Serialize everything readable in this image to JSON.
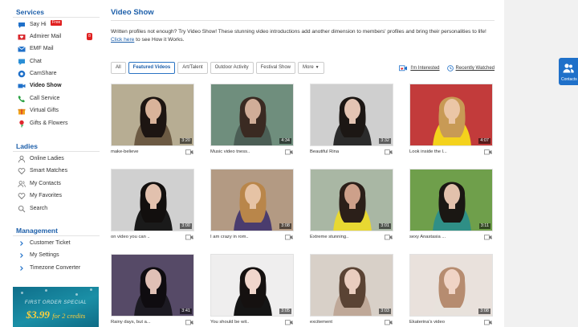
{
  "sidebar": {
    "services_title": "Services",
    "services": [
      {
        "label": "Say Hi",
        "icon": "speech-bubble-icon"
      },
      {
        "label": "Admirer Mail",
        "icon": "mail-heart-icon"
      },
      {
        "label": "EMF Mail",
        "icon": "mail-icon"
      },
      {
        "label": "Chat",
        "icon": "chat-icon"
      },
      {
        "label": "CamShare",
        "icon": "camshare-icon"
      },
      {
        "label": "Video Show",
        "icon": "video-camera-icon"
      },
      {
        "label": "Call Service",
        "icon": "phone-icon"
      },
      {
        "label": "Virtual Gifts",
        "icon": "gift-icon"
      },
      {
        "label": "Gifts & Flowers",
        "icon": "flower-icon"
      }
    ],
    "free_badge": "Free",
    "admirer_count": "8",
    "ladies_title": "Ladies",
    "ladies": [
      {
        "label": "Online Ladies",
        "icon": "person-icon"
      },
      {
        "label": "Smart Matches",
        "icon": "heart-outline-icon"
      },
      {
        "label": "My Contacts",
        "icon": "contacts-icon"
      },
      {
        "label": "My Favorites",
        "icon": "heart-outline-icon"
      },
      {
        "label": "Search",
        "icon": "search-icon"
      }
    ],
    "management_title": "Management",
    "management": [
      {
        "label": "Customer Ticket"
      },
      {
        "label": "My Settings"
      },
      {
        "label": "Timezone Converter"
      }
    ],
    "promo": {
      "line1": "FIRST ORDER SPECIAL",
      "price": "$3.99",
      "tail": "for 2 credits"
    }
  },
  "main": {
    "title": "Video Show",
    "intro_text": "Written profiles not enough? Try Video Show! These stunning video introductions add another dimension to members' profiles and bring their personalities to life!",
    "intro_link": "Click here",
    "intro_tail": "to see How it Works.",
    "filters": [
      "All",
      "Featured Videos",
      "Art/Talent",
      "Outdoor Activity",
      "Festival Show",
      "More"
    ],
    "active_filter": "Featured Videos",
    "im_interested": "I'm Interested",
    "recently_watched": "Recently Watched"
  },
  "videos": [
    {
      "caption": "make-believe",
      "duration": "3:20",
      "bg": "#b7ad93",
      "hair": "#1d1512",
      "skin": "#d9b39a",
      "top": "#6c5a43"
    },
    {
      "caption": "Music video tness..",
      "duration": "4:34",
      "bg": "#6f8e7d",
      "hair": "#3a2a22",
      "skin": "#d0ad98",
      "top": "#4b5e55"
    },
    {
      "caption": "Beautiful Rina",
      "duration": "3:32",
      "bg": "#cfcfcf",
      "hair": "#1c1714",
      "skin": "#e3c4b3",
      "top": "#2b2b2b"
    },
    {
      "caption": "Look inside the l...",
      "duration": "4:07",
      "bg": "#c23b3b",
      "hair": "#c89a55",
      "skin": "#ebc6a6",
      "top": "#f4d21c"
    },
    {
      "caption": "on video you can ..",
      "duration": "3:00",
      "bg": "#d0d0d0",
      "hair": "#120f0e",
      "skin": "#e2c1ae",
      "top": "#1a1a1a"
    },
    {
      "caption": "I am crazy in rom..",
      "duration": "3:08",
      "bg": "#b39a83",
      "hair": "#b9864a",
      "skin": "#e6c3a5",
      "top": "#4a3c6e"
    },
    {
      "caption": "Extreme stunning..",
      "duration": "3:01",
      "bg": "#a9b7a4",
      "hair": "#2b1f19",
      "skin": "#cda08a",
      "top": "#e8d832"
    },
    {
      "caption": "sexy Anastasia ...",
      "duration": "3:11",
      "bg": "#6f9f4b",
      "hair": "#1a1713",
      "skin": "#e2c1ac",
      "top": "#2f8f86"
    },
    {
      "caption": "Rainy days, but a...",
      "duration": "3:41",
      "bg": "#564a67",
      "hair": "#0f0c10",
      "skin": "#e0c0b6",
      "top": "#1c1a22"
    },
    {
      "caption": "You should be wit..",
      "duration": "3:05",
      "bg": "#efeeee",
      "hair": "#151110",
      "skin": "#f0d6cc",
      "top": "#151515"
    },
    {
      "caption": "excitement",
      "duration": "3:03",
      "bg": "#d8d0c8",
      "hair": "#5a4334",
      "skin": "#e9cdbf",
      "top": "#bfa898"
    },
    {
      "caption": "Ekaterina's video",
      "duration": "3:08",
      "bg": "#e9e1dc",
      "hair": "#b68c70",
      "skin": "#f0d4c6",
      "top": "#e8e2dc"
    }
  ],
  "contacts_tab": {
    "label": "Contacts"
  },
  "colors": {
    "accent": "#1d5faa",
    "badge": "#e02020",
    "tab": "#1f70c9"
  }
}
